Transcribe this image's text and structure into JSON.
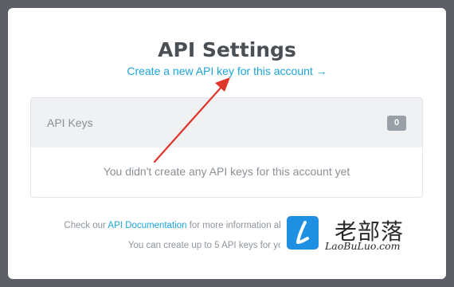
{
  "modal": {
    "title": "API Settings",
    "create_link": "Create a new API key for this account →"
  },
  "keys_panel": {
    "title": "API Keys",
    "count": "0",
    "empty_message": "You didn't create any API keys for this account yet"
  },
  "footer": {
    "line1_prefix": "Check our ",
    "doc_link": "API Documentation",
    "line1_suffix": " for more information about available API methods",
    "line2": "You can create up to 5 API keys for your account"
  },
  "watermark": {
    "logo_icon": "laobuluo-logo-icon",
    "name_cn": "老部落",
    "name_en": "LaoBuLuo.com"
  },
  "colors": {
    "link": "#1ba4d8",
    "annotation_arrow": "#e0352b",
    "badge": "#9aa0a7"
  }
}
